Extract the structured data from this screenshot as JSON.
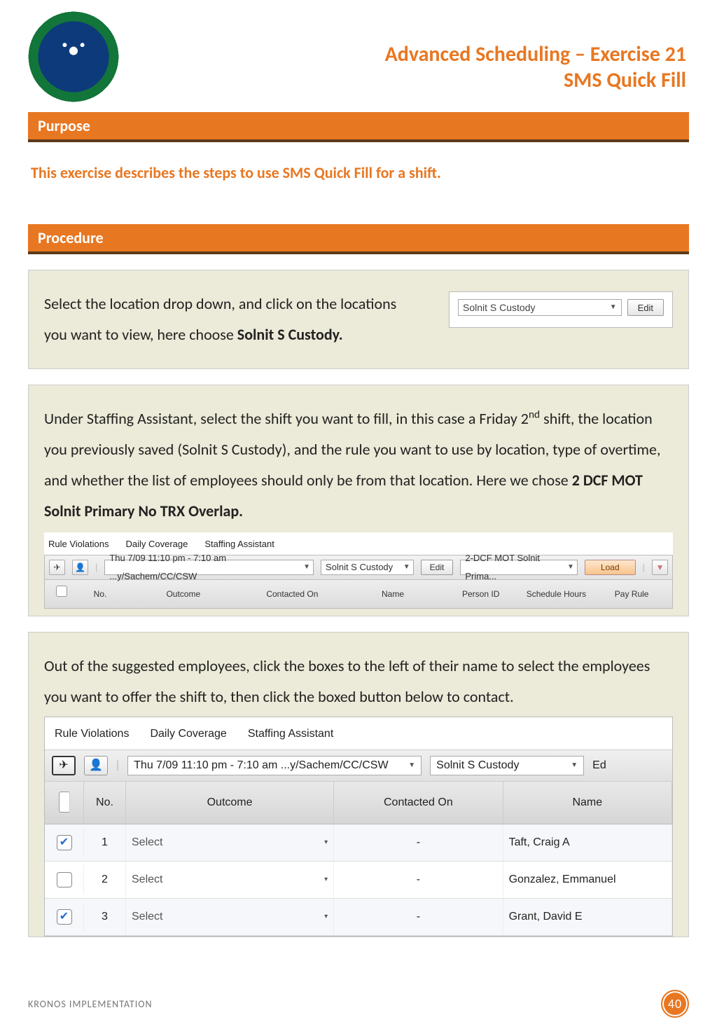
{
  "header": {
    "title_line1": "Advanced Scheduling – Exercise 21",
    "title_line2": "SMS Quick Fill"
  },
  "sections": {
    "purpose_label": "Purpose",
    "purpose_text": "This exercise describes the steps to use SMS Quick Fill for a shift.",
    "procedure_label": "Procedure"
  },
  "step1": {
    "text_a": "Select the location drop down, and click on the locations you want to view, here choose ",
    "text_b": "Solnit S Custody.",
    "widget": {
      "location": "Solnit S Custody",
      "edit": "Edit"
    }
  },
  "step2": {
    "para": "Under Staffing Assistant, select the shift you want to fill, in this case a Friday 2",
    "para_sup": "nd",
    "para_cont": " shift, the location you previously saved (Solnit S Custody), and the rule you want to use by location, type of overtime, and whether the list of employees should only be from that location. Here we chose ",
    "para_bold": "2 DCF MOT Solnit Primary No TRX Overlap."
  },
  "sa1": {
    "tabs": [
      "Rule Violations",
      "Daily Coverage",
      "Staffing Assistant"
    ],
    "shift": "Thu 7/09 11:10 pm - 7:10 am ...y/Sachem/CC/CSW",
    "location": "Solnit S Custody",
    "edit": "Edit",
    "rule": "2-DCF MOT Solnit Prima...",
    "load": "Load",
    "cols": [
      "",
      "No.",
      "Outcome",
      "Contacted On",
      "Name",
      "Person ID",
      "Schedule Hours",
      "Pay Rule"
    ]
  },
  "step3": {
    "para": "Out of the suggested employees, click the boxes to the left of their name to select the employees you want to offer the shift to, then click the boxed button below to contact."
  },
  "sa2": {
    "tabs": [
      "Rule Violations",
      "Daily Coverage",
      "Staffing Assistant"
    ],
    "shift": "Thu 7/09 11:10 pm - 7:10 am ...y/Sachem/CC/CSW",
    "location": "Solnit S Custody",
    "edit_partial": "Ed",
    "cols": [
      "",
      "No.",
      "Outcome",
      "Contacted On",
      "Name"
    ],
    "rows": [
      {
        "checked": true,
        "no": "1",
        "outcome": "Select",
        "contacted": "-",
        "name": "Taft, Craig A"
      },
      {
        "checked": false,
        "no": "2",
        "outcome": "Select",
        "contacted": "-",
        "name": "Gonzalez, Emmanuel"
      },
      {
        "checked": true,
        "no": "3",
        "outcome": "Select",
        "contacted": "-",
        "name": "Grant, David E"
      }
    ]
  },
  "footer": {
    "text": "KRONOS IMPLEMENTATION",
    "page": "40"
  }
}
